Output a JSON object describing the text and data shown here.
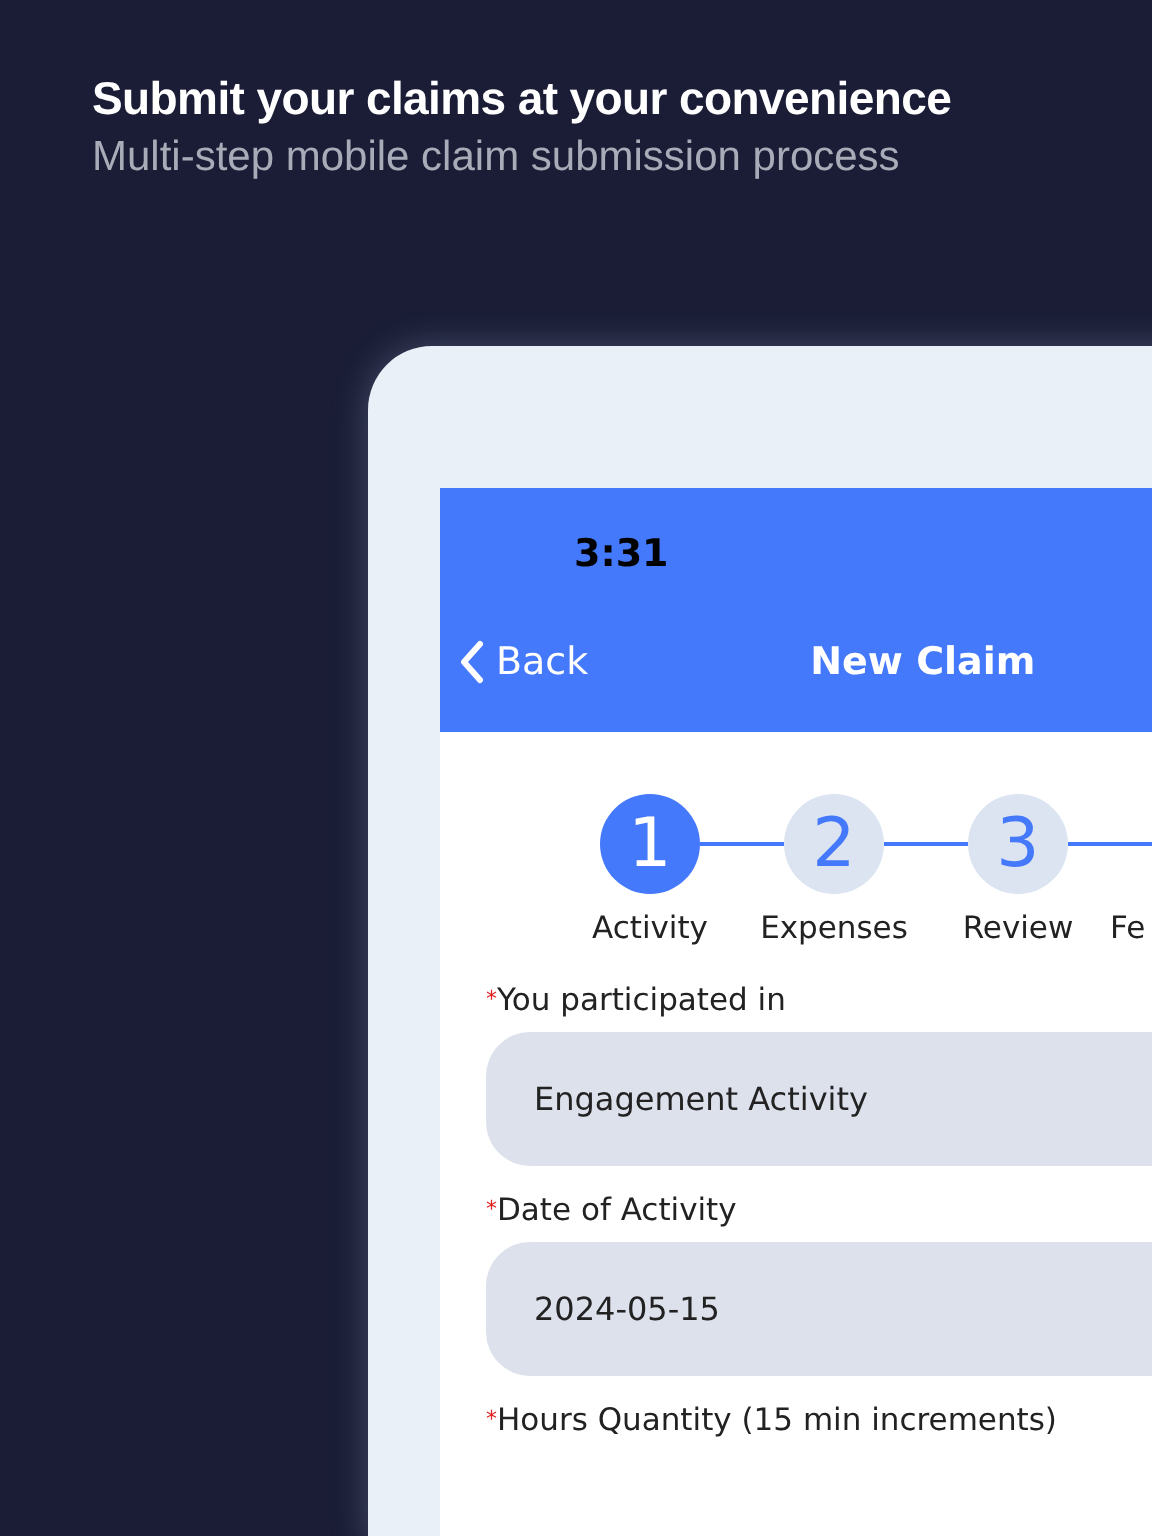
{
  "headline": "Submit your claims at your convenience",
  "subheadline": "Multi-step mobile claim submission process",
  "status_bar": {
    "time": "3:31"
  },
  "nav_bar": {
    "back": "Back",
    "title": "New Claim"
  },
  "steps": [
    {
      "number": "1",
      "label": "Activity",
      "selected": true
    },
    {
      "number": "2",
      "label": "Expenses",
      "selected": false
    },
    {
      "number": "3",
      "label": "Review",
      "selected": false
    },
    {
      "label": "Fe"
    }
  ],
  "fields": [
    {
      "mark": "*",
      "label": "You participated in",
      "value": "Engagement Activity"
    },
    {
      "mark": "*",
      "label": "Date of Activity",
      "value": "2024-05-15"
    },
    {
      "mark": "*",
      "label": "Hours Quantity (15 min increments)"
    }
  ]
}
